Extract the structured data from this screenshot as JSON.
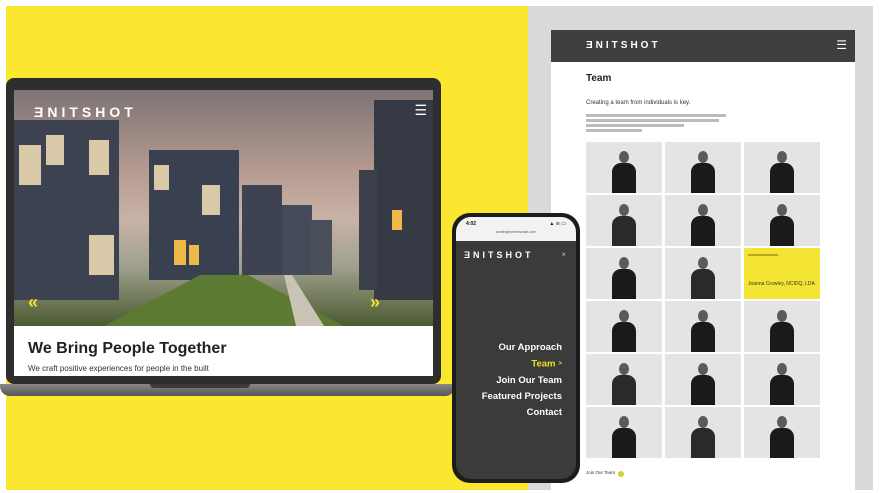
{
  "colors": {
    "accent_yellow": "#fce730",
    "dark_header": "#3f3f3f",
    "active_nav": "#f3df1f"
  },
  "laptop": {
    "logo": "ƎNITSHOT",
    "menu_icon": "hamburger-icon",
    "prev_arrow": "«",
    "next_arrow": "»",
    "headline": "We Bring People Together",
    "tagline": "We craft positive experiences for people in the built"
  },
  "team_page": {
    "logo": "ƎNITSHOT",
    "menu_icon": "hamburger-icon",
    "title": "Team",
    "subtitle": "Creating a team from individuals is key.",
    "highlight_name": "Joanna Crowley, NCIDQ, LDA",
    "join_link": "Join Our Team"
  },
  "phone": {
    "time": "4:02",
    "signal": "▲ ≋ ▭",
    "url": "workinghomeshouse.com",
    "logo": "ƎNITSHOT",
    "close_icon": "×",
    "nav": [
      {
        "label": "Our Approach",
        "active": false
      },
      {
        "label": "Team",
        "active": true
      },
      {
        "label": "Join Our Team",
        "active": false
      },
      {
        "label": "Featured Projects",
        "active": false
      },
      {
        "label": "Contact",
        "active": false
      }
    ]
  }
}
